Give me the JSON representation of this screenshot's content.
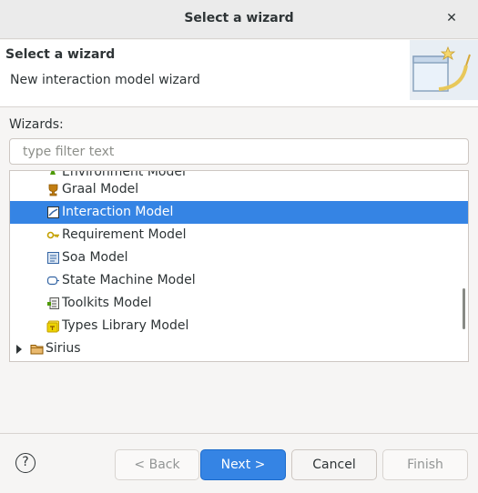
{
  "window": {
    "title": "Select a wizard"
  },
  "banner": {
    "heading": "Select a wizard",
    "description": "New interaction model wizard"
  },
  "wizards": {
    "label": "Wizards:",
    "filter_placeholder": "type filter text",
    "items": [
      {
        "label": "Environment Model",
        "icon": "environment-model-icon"
      },
      {
        "label": "Graal Model",
        "icon": "graal-model-icon"
      },
      {
        "label": "Interaction Model",
        "icon": "interaction-model-icon",
        "selected": true
      },
      {
        "label": "Requirement Model",
        "icon": "requirement-model-icon"
      },
      {
        "label": "Soa Model",
        "icon": "soa-model-icon"
      },
      {
        "label": "State Machine Model",
        "icon": "state-machine-model-icon"
      },
      {
        "label": "Toolkits Model",
        "icon": "toolkits-model-icon"
      },
      {
        "label": "Types Library Model",
        "icon": "types-library-model-icon"
      },
      {
        "label": "Sirius",
        "icon": "folder-icon",
        "collapsed": true
      }
    ]
  },
  "buttons": {
    "help": "?",
    "back": "< Back",
    "next": "Next >",
    "cancel": "Cancel",
    "finish": "Finish"
  },
  "colors": {
    "selection": "#3584e4",
    "primary_button": "#3584e4"
  }
}
